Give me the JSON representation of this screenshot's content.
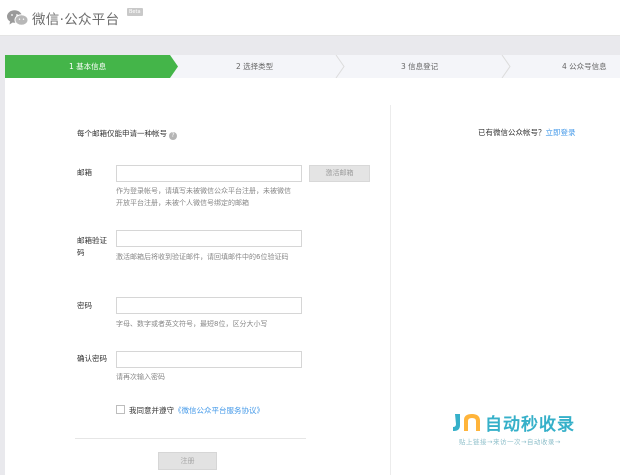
{
  "app": {
    "logo_icon": "wechat-logo-icon",
    "title": "微信·公众平台",
    "badge": "Beta"
  },
  "steps": [
    {
      "label": "1 基本信息",
      "active": true
    },
    {
      "label": "2 选择类型",
      "active": false
    },
    {
      "label": "3 信息登记",
      "active": false
    },
    {
      "label": "4 公众号信息",
      "active": false
    }
  ],
  "colors": {
    "accent": "#44b549",
    "link": "#459ae9",
    "page_bg": "#e9e9ed"
  },
  "form": {
    "notice": "每个邮箱仅能申请一种帐号",
    "help_icon": "question-icon",
    "email": {
      "label": "邮箱",
      "value": "",
      "hint": "作为登录帐号，请填写未被微信公众平台注册，未被微信开放平台注册，未被个人微信号绑定的邮箱",
      "activate_button": "激活邮箱"
    },
    "verify_code": {
      "label": "邮箱验证码",
      "value": "",
      "hint": "激活邮箱后将收到验证邮件，请回填邮件中的6位验证码"
    },
    "password": {
      "label": "密码",
      "value": "",
      "hint": "字母、数字或者英文符号，最短8位，区分大小写"
    },
    "confirm_password": {
      "label": "确认密码",
      "value": "",
      "hint": "请再次输入密码"
    },
    "agreement": {
      "prefix": "我同意并遵守",
      "link": "《微信公众平台服务协议》",
      "checked": false
    },
    "register_button": "注册"
  },
  "sidebar": {
    "question": "已有微信公众帐号？",
    "login_link": "立即登录"
  },
  "watermark": {
    "title": "自动秒收录",
    "subtitle": "贴上链接→来访一次→自动收录→"
  }
}
